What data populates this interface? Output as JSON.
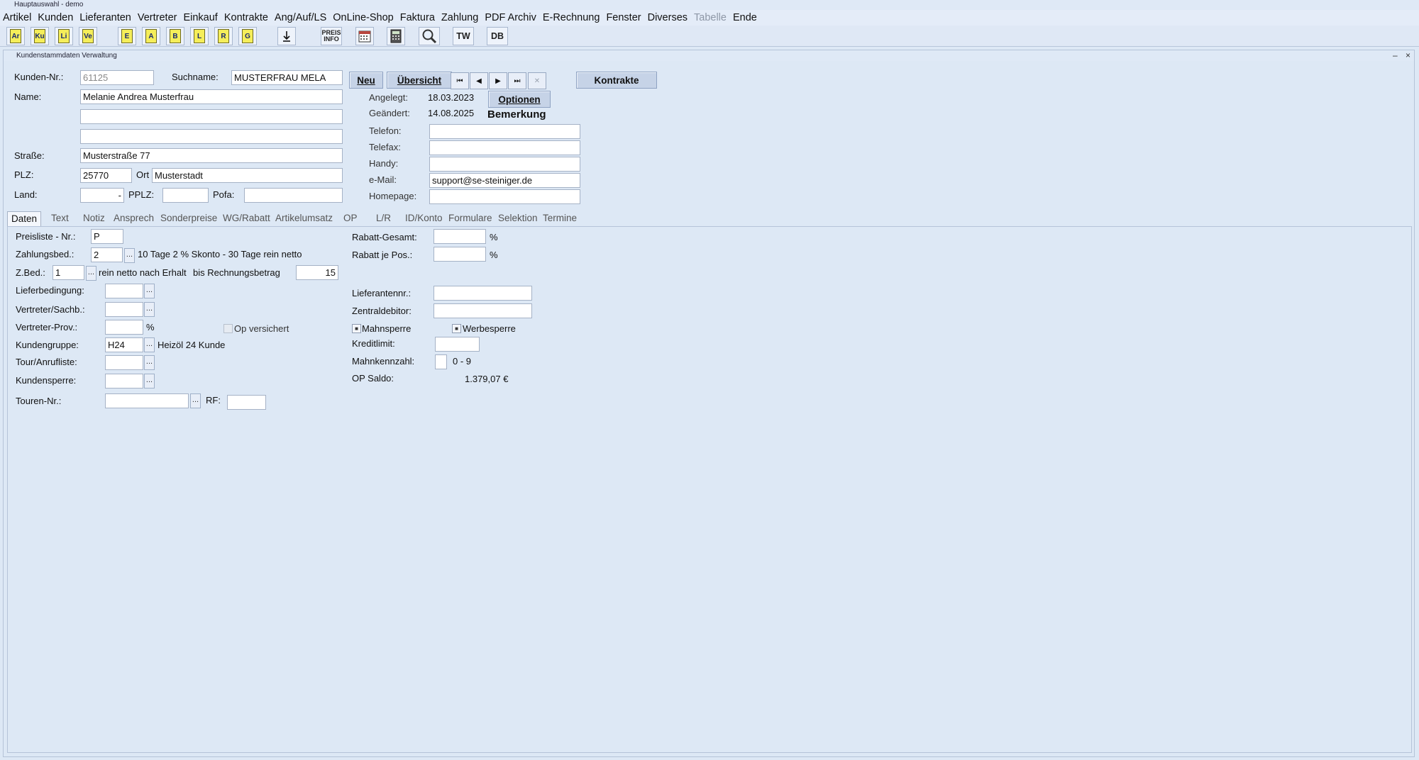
{
  "app": {
    "title": "Hauptauswahl - demo"
  },
  "menu": [
    "Artikel",
    "Kunden",
    "Lieferanten",
    "Vertreter",
    "Einkauf",
    "Kontrakte",
    "Ang/Auf/LS",
    "OnLine-Shop",
    "Faktura",
    "Zahlung",
    "PDF Archiv",
    "E-Rechnung",
    "Fenster",
    "Diverses",
    "Tabelle",
    "Ende"
  ],
  "toolbar": {
    "art": "Ar",
    "ku": "Ku",
    "li": "Li",
    "ve": "Ve",
    "e": "E",
    "a": "A",
    "b": "B",
    "l": "L",
    "r": "R",
    "g": "G",
    "preis_top": "PREIS",
    "preis_bottom": "INFO",
    "tw": "TW",
    "db": "DB"
  },
  "window": {
    "title": "Kundenstammdaten Verwaltung",
    "minimize": "–",
    "close": "×"
  },
  "header": {
    "kunden_nr_label": "Kunden-Nr.:",
    "kunden_nr": "61125",
    "suchname_label": "Suchname:",
    "suchname": "MUSTERFRAU MELA",
    "name_label": "Name:",
    "name1": "Melanie Andrea Musterfrau",
    "name2": "",
    "name3": "",
    "strasse_label": "Straße:",
    "strasse": "Musterstraße 77",
    "plz_label": "PLZ:",
    "plz": "25770",
    "ort_label": "Ort",
    "ort": "Musterstadt",
    "land_label": "Land:",
    "land": "-",
    "pplz_label": "PPLZ:",
    "pplz": "",
    "pofa_label": "Pofa:",
    "pofa": "",
    "neu_btn": "Neu",
    "uebersicht_btn": "Übersicht",
    "kontrakte_btn": "Kontrakte",
    "optionen_btn": "Optionen",
    "angelegt_label": "Angelegt:",
    "angelegt": "18.03.2023",
    "geaendert_label": "Geändert:",
    "geaendert": "14.08.2025",
    "bemerkung": "Bemerkung",
    "telefon_label": "Telefon:",
    "telefon": "",
    "telefax_label": "Telefax:",
    "telefax": "",
    "handy_label": "Handy:",
    "handy": "",
    "email_label": "e-Mail:",
    "email": "support@se-steiniger.de",
    "homepage_label": "Homepage:",
    "homepage": ""
  },
  "nav": {
    "first": "⏮",
    "prev": "◀",
    "next": "▶",
    "last": "⏭",
    "delete": "✕"
  },
  "tabs": [
    "Daten",
    "Text",
    "Notiz",
    "Ansprech",
    "Sonderpreise",
    "WG/Rabatt",
    "Artikelumsatz",
    "OP",
    "L/R",
    "ID/Konto",
    "Formulare",
    "Selektion",
    "Termine"
  ],
  "daten": {
    "preisliste_label": "Preisliste - Nr.:",
    "preisliste": "P",
    "zahlungsbed_label": "Zahlungsbed.:",
    "zahlungsbed": "2",
    "zahlungsbed_text": "10 Tage 2 % Skonto - 30 Tage rein netto",
    "zbed_label": "Z.Bed.:",
    "zbed": "1",
    "zbed_text": "rein netto nach Erhalt",
    "bis_label": "bis Rechnungsbetrag",
    "bis_value": "15",
    "lieferbedingung_label": "Lieferbedingung:",
    "lieferbedingung": "",
    "vertreter_label": "Vertreter/Sachb.:",
    "vertreter": "",
    "vertreter_prov_label": "Vertreter-Prov.:",
    "vertreter_prov": "",
    "percent": "%",
    "op_versichert_label": "Op versichert",
    "kundengruppe_label": "Kundengruppe:",
    "kundengruppe": "H24",
    "kundengruppe_text": "Heizöl 24 Kunde",
    "tour_label": "Tour/Anrufliste:",
    "tour": "",
    "kundensperre_label": "Kundensperre:",
    "kundensperre": "",
    "touren_nr_label": "Touren-Nr.:",
    "touren_nr": "",
    "rf_label": "RF:",
    "rf": "",
    "rabatt_gesamt_label": "Rabatt-Gesamt:",
    "rabatt_gesamt": "",
    "rabatt_pos_label": "Rabatt je Pos.:",
    "rabatt_pos": "",
    "lieferantennr_label": "Lieferantennr.:",
    "lieferantennr": "",
    "zentraldebitor_label": "Zentraldebitor:",
    "zentraldebitor": "",
    "mahnsperre_label": "Mahnsperre",
    "werbesperre_label": "Werbesperre",
    "kreditlimit_label": "Kreditlimit:",
    "kreditlimit": "",
    "mahnkennzahl_label": "Mahnkennzahl:",
    "mahnkennzahl": "",
    "mahnkennzahl_range": "0 - 9",
    "op_saldo_label": "OP Saldo:",
    "op_saldo": "1.379,07 €",
    "dots": "..."
  }
}
